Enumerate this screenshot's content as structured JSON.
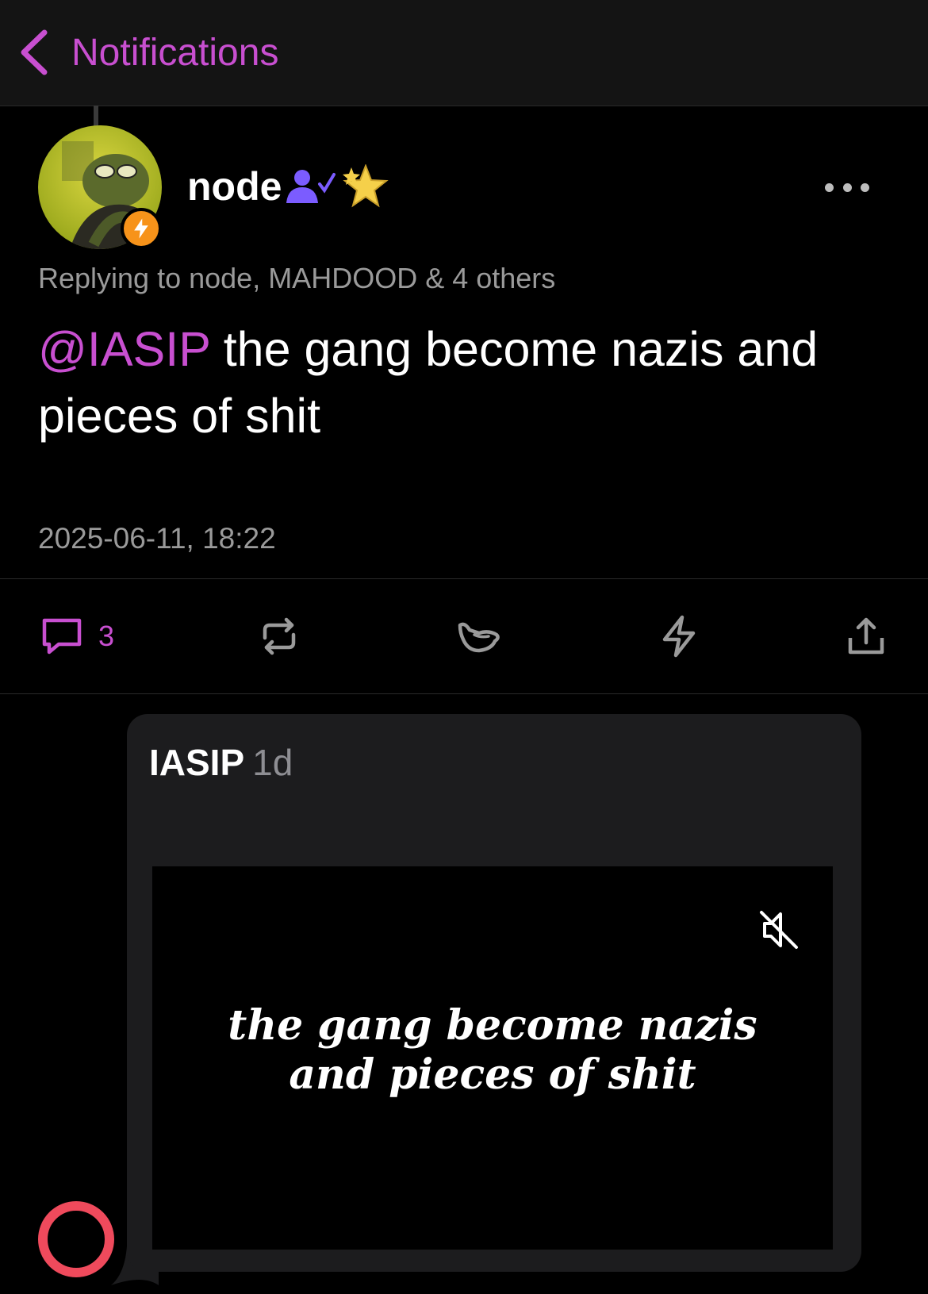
{
  "navbar": {
    "back_label": "Notifications",
    "accent_color": "#c84fd0"
  },
  "post": {
    "author": "node",
    "reply_context": "Replying to node, MAHDOOD & 4 others",
    "mention": "@IASIP",
    "text": " the gang become nazis and pieces of shit",
    "timestamp": "2025-06-11, 18:22"
  },
  "actions": {
    "reply_count": "3",
    "icons": [
      "comment-icon",
      "repost-icon",
      "shaka-icon",
      "zap-icon",
      "share-icon"
    ]
  },
  "quote": {
    "author": "IASIP",
    "age": "1d",
    "caption_line1": "the gang become nazis",
    "caption_line2": "and pieces of shit"
  }
}
